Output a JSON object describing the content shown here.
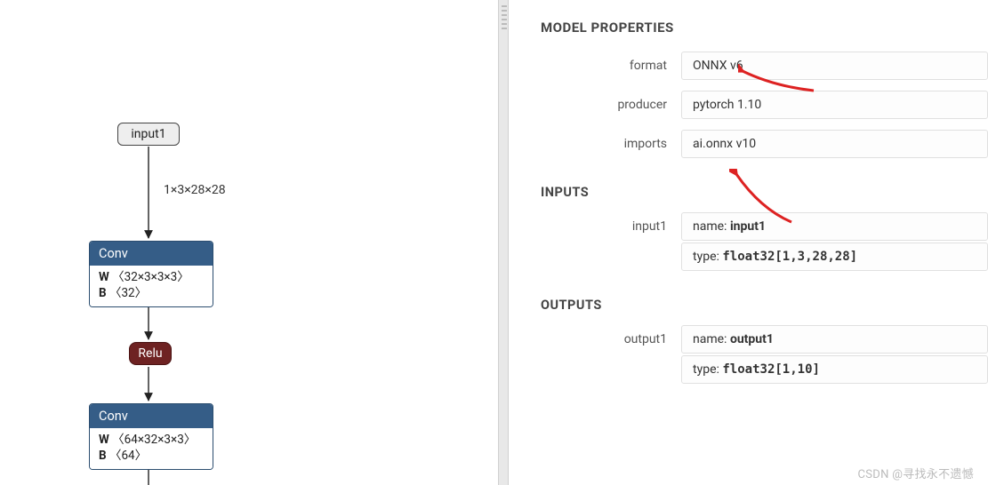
{
  "panel_title": "MODEL PROPERTIES",
  "model_properties": {
    "format": {
      "label": "format",
      "value": "ONNX v6"
    },
    "producer": {
      "label": "producer",
      "value": "pytorch 1.10"
    },
    "imports": {
      "label": "imports",
      "value": "ai.onnx v10"
    }
  },
  "inputs_title": "INPUTS",
  "inputs": {
    "input1": {
      "label": "input1",
      "name_label": "name:",
      "name": "input1",
      "type_label": "type:",
      "type": "float32[1,3,28,28]"
    }
  },
  "outputs_title": "OUTPUTS",
  "outputs": {
    "output1": {
      "label": "output1",
      "name_label": "name:",
      "name": "output1",
      "type_label": "type:",
      "type": "float32[1,10]"
    }
  },
  "graph": {
    "input_node": "input1",
    "edge1_label": "1×3×28×28",
    "conv1": {
      "title": "Conv",
      "w": "W 〈32×3×3×3〉",
      "b": "B 〈32〉"
    },
    "relu": {
      "title": "Relu"
    },
    "conv2": {
      "title": "Conv",
      "w": "W 〈64×32×3×3〉",
      "b": "B 〈64〉"
    }
  },
  "watermark": "CSDN @寻找永不遗憾"
}
